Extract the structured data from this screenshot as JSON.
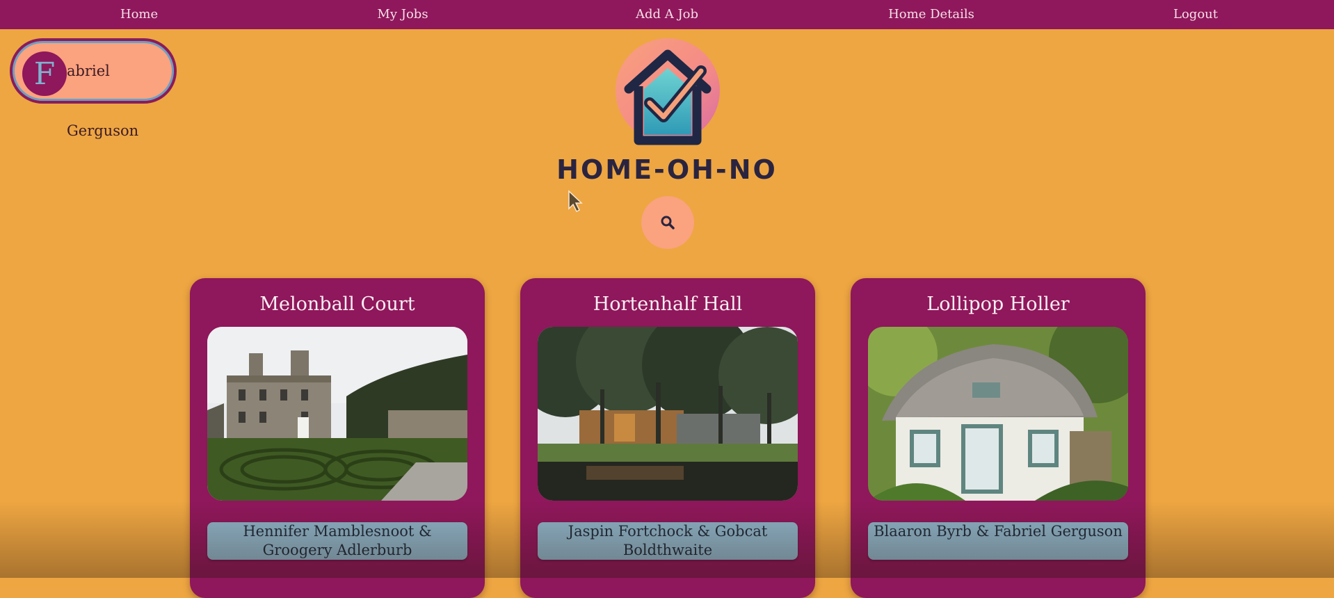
{
  "nav": {
    "items": [
      {
        "label": "Home"
      },
      {
        "label": "My Jobs"
      },
      {
        "label": "Add A Job"
      },
      {
        "label": "Home Details"
      },
      {
        "label": "Logout"
      }
    ]
  },
  "user": {
    "initial": "F",
    "name": "abriel Gerguson"
  },
  "brand": {
    "title": "HOME-OH-NO",
    "logo_icon": "house-check-logo"
  },
  "search": {
    "icon": "search-icon"
  },
  "colors": {
    "background": "#eea642",
    "primary": "#8f175b",
    "accent": "#fba27e",
    "badge": "#8db2c6"
  },
  "homes": [
    {
      "name": "Melonball Court",
      "owners": "Hennifer Mamblesnoot & Groogery Adlerburb"
    },
    {
      "name": "Hortenhalf Hall",
      "owners": "Jaspin Fortchock & Gobcat Boldthwaite"
    },
    {
      "name": "Lollipop Holler",
      "owners": "Blaaron Byrb & Fabriel Gerguson"
    }
  ]
}
